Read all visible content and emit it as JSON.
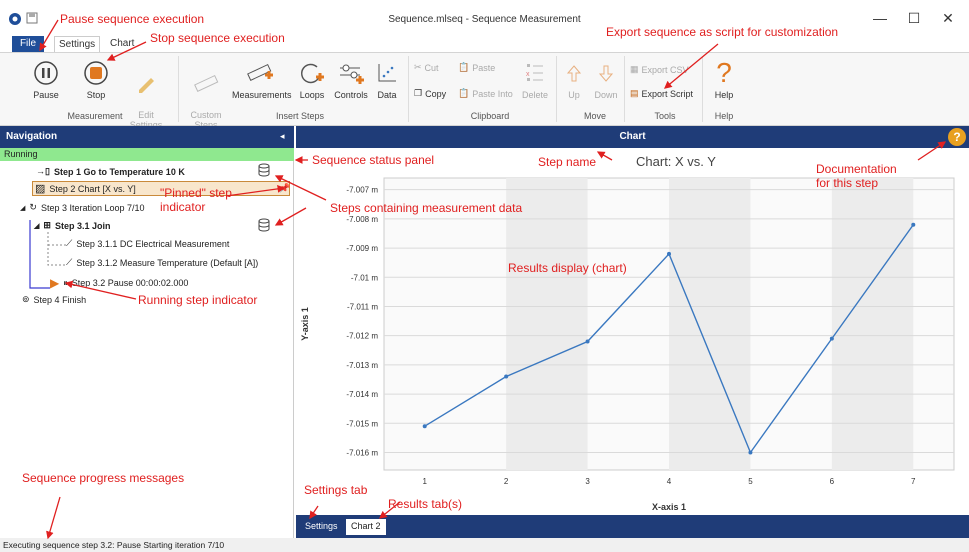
{
  "window": {
    "title": "Sequence.mlseq - Sequence Measurement",
    "minimize": "—",
    "maximize": "☐",
    "close": "✕"
  },
  "tabs": {
    "file": "File",
    "settings": "Settings",
    "chart": "Chart"
  },
  "ribbon": {
    "pause": "Pause",
    "stop": "Stop",
    "edit_settings": "Edit\nSettings",
    "custom_steps": "Custom\nSteps",
    "measurements": "Measurements",
    "loops": "Loops",
    "controls": "Controls",
    "data": "Data",
    "cut": "Cut",
    "copy": "Copy",
    "paste": "Paste",
    "paste_into": "Paste Into",
    "delete": "Delete",
    "up": "Up",
    "down": "Down",
    "export_csv": "Export CSV",
    "export_script": "Export Script",
    "help": "Help",
    "groups": {
      "measurement": "Measurement",
      "insert_steps": "Insert Steps",
      "clipboard": "Clipboard",
      "move": "Move",
      "tools": "Tools",
      "help": "Help"
    }
  },
  "nav": {
    "header": "Navigation",
    "collapse": "◂",
    "status": "Running",
    "steps": [
      "Step 1 Go to Temperature 10 K",
      "Step 2 Chart [X vs. Y]",
      "Step 3 Iteration Loop 7/10",
      "Step 3.1 Join",
      "Step 3.1.1 DC Electrical Measurement",
      "Step 3.1.2 Measure Temperature (Default [A])",
      "Step 3.2 Pause 00:00:02.000",
      "Step 4 Finish"
    ]
  },
  "chart_panel": {
    "header": "Chart",
    "help": "?"
  },
  "chart_data": {
    "type": "line",
    "title": "Chart: X vs. Y",
    "xlabel": "X-axis 1",
    "ylabel": "Y-axis 1",
    "x": [
      1,
      2,
      3,
      4,
      5,
      6,
      7
    ],
    "values": [
      -7.0151,
      -7.0134,
      -7.0122,
      -7.0092,
      -7.016,
      -7.0121,
      -7.0082
    ],
    "xlim": [
      0.5,
      7.5
    ],
    "ylim": [
      -7.0166,
      -7.0066
    ],
    "yticks": [
      "-7.007 m",
      "-7.008 m",
      "-7.009 m",
      "-7.01 m",
      "-7.011 m",
      "-7.012 m",
      "-7.013 m",
      "-7.014 m",
      "-7.015 m",
      "-7.016 m"
    ],
    "xticks": [
      "1",
      "2",
      "3",
      "4",
      "5",
      "6",
      "7"
    ],
    "grid": true,
    "color": "#3a78c0"
  },
  "bottom_tabs": {
    "settings": "Settings",
    "chart2": "Chart 2"
  },
  "statusbar": "Executing sequence step 3.2:  Pause  Starting iteration 7/10",
  "annotations": {
    "pause": "Pause sequence execution",
    "stop": "Stop sequence execution",
    "export": "Export sequence as script for customization",
    "status_panel": "Sequence status panel",
    "step_name": "Step name",
    "documentation": "Documentation\nfor this step",
    "steps_data": "Steps containing measurement data",
    "pinned": "\"Pinned\" step\nindicator",
    "results": "Results display (chart)",
    "running": "Running step indicator",
    "progress": "Sequence progress messages",
    "settings_tab": "Settings tab",
    "results_tabs": "Results tab(s)"
  },
  "colors": {
    "header": "#1f3c78",
    "status": "#8fe88f",
    "annotation": "#e02020",
    "running": "#e07820"
  }
}
